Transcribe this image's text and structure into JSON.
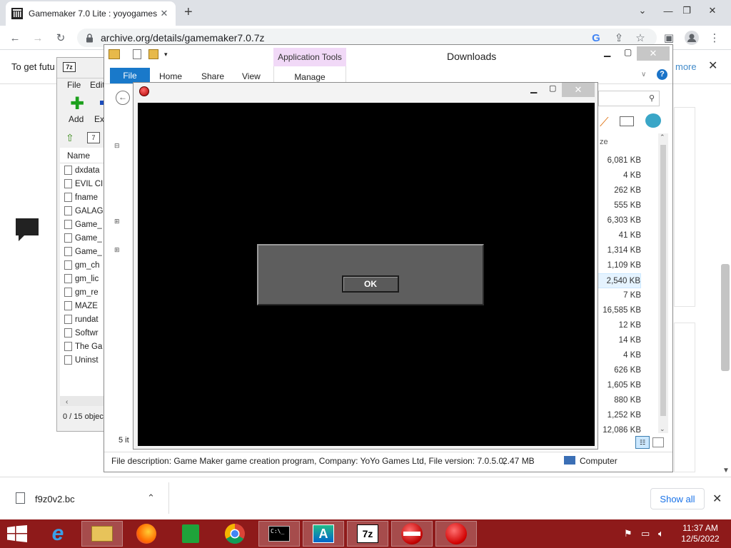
{
  "browser": {
    "tab_title": "Gamemaker 7.0 Lite : yoyogames",
    "url": "archive.org/details/gamemaker7.0.7z",
    "new_tab": "+"
  },
  "infobar": {
    "text": "To get futu",
    "more": "more"
  },
  "sevenzip": {
    "logo": "7z",
    "menu_file": "File",
    "menu_edit": "Edit",
    "add_label": "Add",
    "extract_label": "Ext",
    "col_name": "Name",
    "files": [
      "dxdata",
      "EVIL CI",
      "fname",
      "GALAG",
      "Game_",
      "Game_",
      "Game_",
      "gm_ch",
      "gm_lic",
      "gm_re",
      "MAZE",
      "rundat",
      "Softwr",
      "The Ga",
      "Uninst"
    ],
    "status": "0 / 15 objec"
  },
  "explorer": {
    "title": "Downloads",
    "app_tools": "Application Tools",
    "ribbon_file": "File",
    "ribbon_home": "Home",
    "ribbon_share": "Share",
    "ribbon_view": "View",
    "ribbon_manage": "Manage",
    "size_col": "ze",
    "sizes": [
      "6,081 KB",
      "4 KB",
      "262 KB",
      "555 KB",
      "6,303 KB",
      "41 KB",
      "1,314 KB",
      "1,109 KB",
      "2,540 KB",
      "7 KB",
      "16,585 KB",
      "12 KB",
      "14 KB",
      "4 KB",
      "626 KB",
      "1,605 KB",
      "880 KB",
      "1,252 KB",
      "12,086 KB"
    ],
    "items_count": "5 it",
    "status_desc": "File description: Game Maker game creation program, Company: YoYo Games Ltd, File version: 7.0.5.0,",
    "status_size": "2.47 MB",
    "status_computer": "Computer"
  },
  "game": {
    "ok_label": "OK"
  },
  "downloads_bar": {
    "filename": "f9z0v2.bc",
    "show_all": "Show all"
  },
  "taskbar": {
    "time": "11:37 AM",
    "date": "12/5/2022",
    "sevenzip_label": "7z"
  },
  "colors": {
    "taskbar": "#8e1a1a",
    "win_blue": "#1979ca",
    "app_tools": "#f1d9f7"
  }
}
